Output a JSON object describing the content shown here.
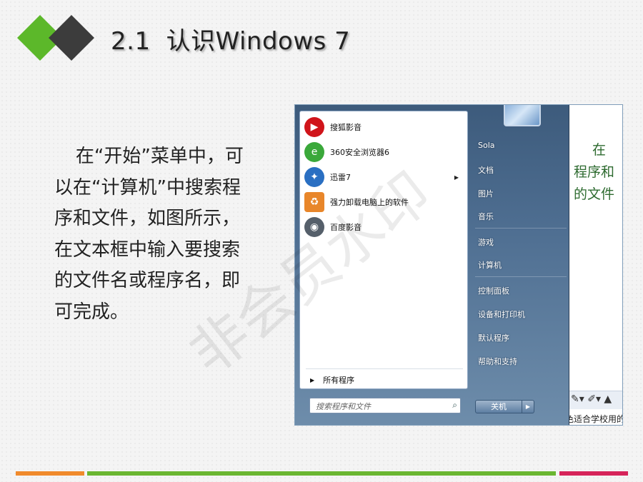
{
  "slide": {
    "title_num": "2.1",
    "title_text": "认识Windows 7",
    "body": "在“开始”菜单中，可以在“计算机”中搜索程序和文件，如图所示，在文本框中输入要搜索的文件名或程序名，即可完成。",
    "watermark": "非会员水印"
  },
  "start_menu": {
    "programs": [
      {
        "label": "搜狐影音",
        "icon": "sohu-video-icon",
        "color": "#d0141a"
      },
      {
        "label": "360安全浏览器6",
        "icon": "360-browser-icon",
        "color": "#3aa83a"
      },
      {
        "label": "迅雷7",
        "icon": "thunder-icon",
        "color": "#2a6fc2"
      },
      {
        "label": "强力卸载电脑上的软件",
        "icon": "uninstall-icon",
        "color": "#e8862a"
      },
      {
        "label": "百度影音",
        "icon": "baidu-player-icon",
        "color": "#555f6a"
      }
    ],
    "all_programs": "所有程序",
    "search_placeholder": "搜索程序和文件",
    "right_items": [
      "Sola",
      "文档",
      "图片",
      "音乐",
      "游戏",
      "计算机",
      "控制面板",
      "设备和打印机",
      "默认程序",
      "帮助和支持"
    ],
    "shutdown": "关机"
  },
  "background_doc": {
    "line1": "在",
    "line2": "程序和",
    "line3": "的文件",
    "status": "色适合学校用的"
  },
  "colors": {
    "logo_green": "#5cb82a",
    "logo_dark": "#3c3c3c",
    "footer_orange": "#f08a2c",
    "footer_green": "#6ab631",
    "footer_red": "#d6245a"
  }
}
